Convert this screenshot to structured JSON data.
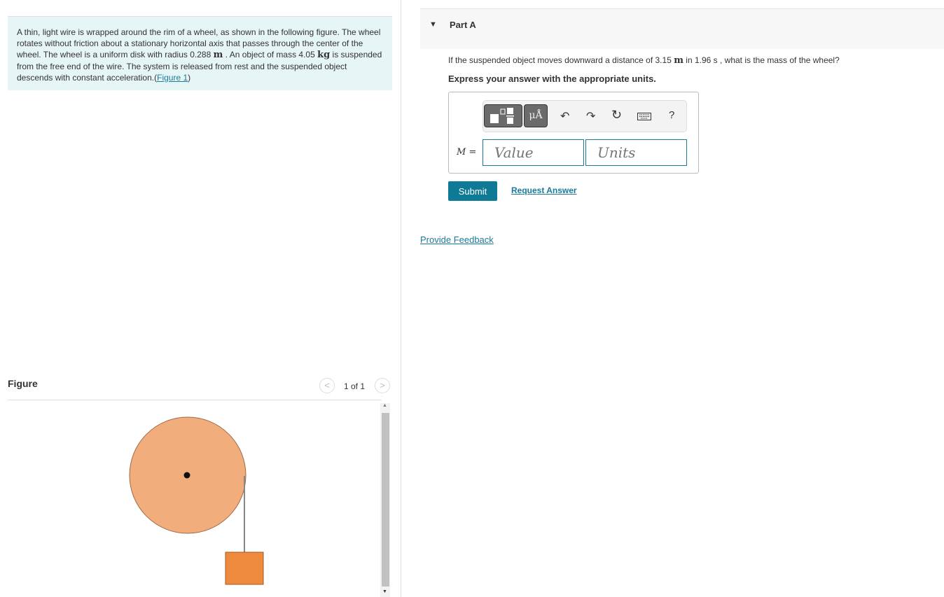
{
  "problem": {
    "line1": "A thin, light wire is wrapped around the rim of a wheel, as shown in the following figure. The wheel rotates without friction about a stationary horizontal axis that passes through the center of the wheel. The wheel is a uniform disk with radius 0.288 ",
    "unit_m": "m",
    "line2": " . An object of mass 4.05 ",
    "unit_kg": "kg",
    "line3": " is suspended from the free end of the wire. The system is released from rest and the suspended object descends with constant acceleration.(",
    "figure_link": "Figure 1",
    "close": ")"
  },
  "figure": {
    "heading": "Figure",
    "pager": "1 of 1",
    "prev": "<",
    "next": ">",
    "colors": {
      "wheel": "#f2ad7c",
      "block": "#ed8a3e"
    }
  },
  "part": {
    "title": "Part A",
    "question_pre": "If the suspended object moves downward a distance of 3.15 ",
    "unit_m": "m",
    "question_post": " in 1.96 s , what is the mass of the wheel?",
    "express": "Express your answer with the appropriate units."
  },
  "answer": {
    "label": "M =",
    "value_placeholder": "Value",
    "units_placeholder": "Units",
    "help": "?",
    "symbols": "μÅ"
  },
  "buttons": {
    "submit": "Submit",
    "request": "Request Answer",
    "feedback": "Provide Feedback"
  }
}
